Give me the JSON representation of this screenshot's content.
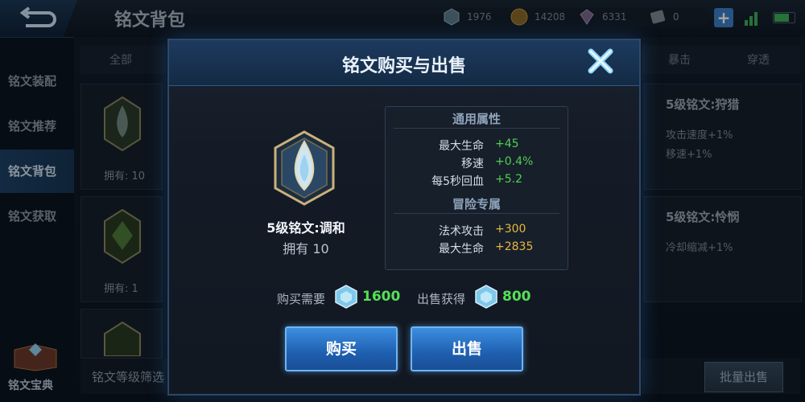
{
  "header": {
    "title": "铭文背包",
    "currencies": [
      {
        "icon": "diamond-icon",
        "value": "1976"
      },
      {
        "icon": "coin-icon",
        "value": "14208"
      },
      {
        "icon": "gem-icon",
        "value": "6331"
      },
      {
        "icon": "voucher-icon",
        "value": "0"
      }
    ]
  },
  "sidebar": {
    "items": [
      {
        "label": "铭文装配"
      },
      {
        "label": "铭文推荐"
      },
      {
        "label": "铭文背包"
      },
      {
        "label": "铭文获取"
      }
    ],
    "codex_label": "铭文宝典"
  },
  "background": {
    "filter_tabs": [
      "全部",
      "暴击",
      "穿透"
    ],
    "cards": [
      {
        "owned": "拥有: 10"
      },
      {
        "owned": "拥有: 1"
      }
    ],
    "right_cards": [
      {
        "title": "5级铭文:狩猎",
        "lines": [
          "攻击速度+1%",
          "移速+1%"
        ]
      },
      {
        "title": "5级铭文:怜悯",
        "lines": [
          "冷却缩减+1%"
        ]
      }
    ],
    "level_filter": "铭文等级筛选",
    "batch_sell": "批量出售"
  },
  "modal": {
    "title": "铭文购买与出售",
    "rune_name": "5级铭文:调和",
    "owned_label": "拥有",
    "owned_value": "10",
    "general_title": "通用属性",
    "general_stats": [
      {
        "label": "最大生命",
        "value": "+45"
      },
      {
        "label": "移速",
        "value": "+0.4%"
      },
      {
        "label": "每5秒回血",
        "value": "+5.2"
      }
    ],
    "adventure_title": "冒险专属",
    "adventure_stats": [
      {
        "label": "法术攻击",
        "value": "+300"
      },
      {
        "label": "最大生命",
        "value": "+2835"
      }
    ],
    "buy_cost_label": "购买需要",
    "buy_cost": "1600",
    "sell_gain_label": "出售获得",
    "sell_gain": "800",
    "buy_button": "购买",
    "sell_button": "出售"
  },
  "colors": {
    "stat_green": "#4fd04f",
    "stat_gold": "#e8b83a",
    "button_blue": "#1e5fb0"
  }
}
